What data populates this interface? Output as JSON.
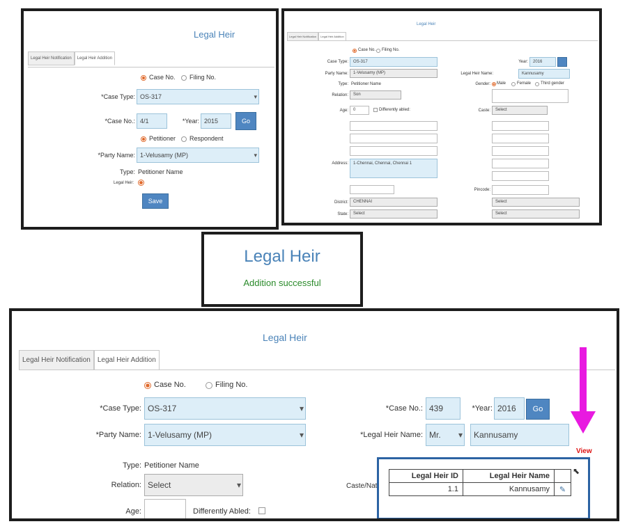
{
  "panel1": {
    "title": "Legal Heir",
    "tabs": [
      "Legal Heir Notification",
      "Legal Heir Addition"
    ],
    "radio_case": "Case No.",
    "radio_filing": "Filing No.",
    "case_type_label": "*Case Type:",
    "case_type_value": "OS-317",
    "case_no_label": "*Case No.:",
    "case_no_value": "4/1",
    "year_label": "*Year:",
    "year_value": "2015",
    "go_label": "Go",
    "radio_petitioner": "Petitioner",
    "radio_respondent": "Respondent",
    "party_label": "*Party Name:",
    "party_value": "1-Velusamy (MP)",
    "type_label": "Type:",
    "type_value": "Petitioner Name",
    "legal_heir_label": "Legal Heir:",
    "save_label": "Save"
  },
  "panel2": {
    "title": "Legal Heir",
    "tabs": [
      "Legal Heir Notification",
      "Legal Heir Addition"
    ],
    "radio_case": "Case No.",
    "radio_filing": "Filing No.",
    "case_type_label": "Case Type:",
    "case_type_value": "OS-317",
    "party_label": "Party Name:",
    "party_value": "1-Velusamy (MP)",
    "type_label": "Type:",
    "type_value": "Petitioner Name",
    "relation_label": "Relation:",
    "relation_value": "Son",
    "age_label": "Age:",
    "age_value": "0",
    "differently_abled": "Differently abled:",
    "address_label": "Address:",
    "address_value": "1-Chennai, Chennai, Chennai 1",
    "district_label": "District:",
    "district_value": "CHENNAI",
    "state_label": "State:",
    "state_value": "Select",
    "lh_name_label": "Legal Heir Name:",
    "lh_name_value": "Kannusamy",
    "gender_label": "Gender:",
    "male": "Male",
    "female": "Female",
    "third": "Third gender",
    "caste_label": "Caste:",
    "caste_value": "Select",
    "year_label": "Year:",
    "year_value": "2016",
    "pincode_label": "Pincode:",
    "state2_value": "Select"
  },
  "toast": {
    "title": "Legal Heir",
    "message": "Addition successful"
  },
  "panel3": {
    "title": "Legal Heir",
    "tabs": [
      "Legal Heir Notification",
      "Legal Heir Addition"
    ],
    "radio_case": "Case No.",
    "radio_filing": "Filing No.",
    "case_type_label": "*Case Type:",
    "case_type_value": "OS-317",
    "party_label": "*Party Name:",
    "party_value": "1-Velusamy (MP)",
    "case_no_label": "*Case No.:",
    "case_no_value": "439",
    "year_label": "*Year:",
    "year_value": "2016",
    "go_label": "Go",
    "lh_name_label": "*Legal Heir Name:",
    "salutation_value": "Mr.",
    "lh_name_value": "Kannusamy",
    "view_label": "View",
    "type_label": "Type:",
    "type_value": "Petitioner Name",
    "relation_label": "Relation:",
    "relation_value": "Select",
    "age_label": "Age:",
    "differently_abled": "Differently Abled:",
    "caste_label": "Caste/Nat",
    "table_headers": [
      "Legal Heir ID",
      "Legal Heir Name"
    ],
    "table_rows": [
      {
        "id": "1.1",
        "name": "Kannusamy"
      }
    ]
  },
  "colors": {
    "accent_blue": "#4f86c1",
    "field_bg": "#ddeef8",
    "arrow": "#e81ae0",
    "success": "#2a8a2a"
  }
}
